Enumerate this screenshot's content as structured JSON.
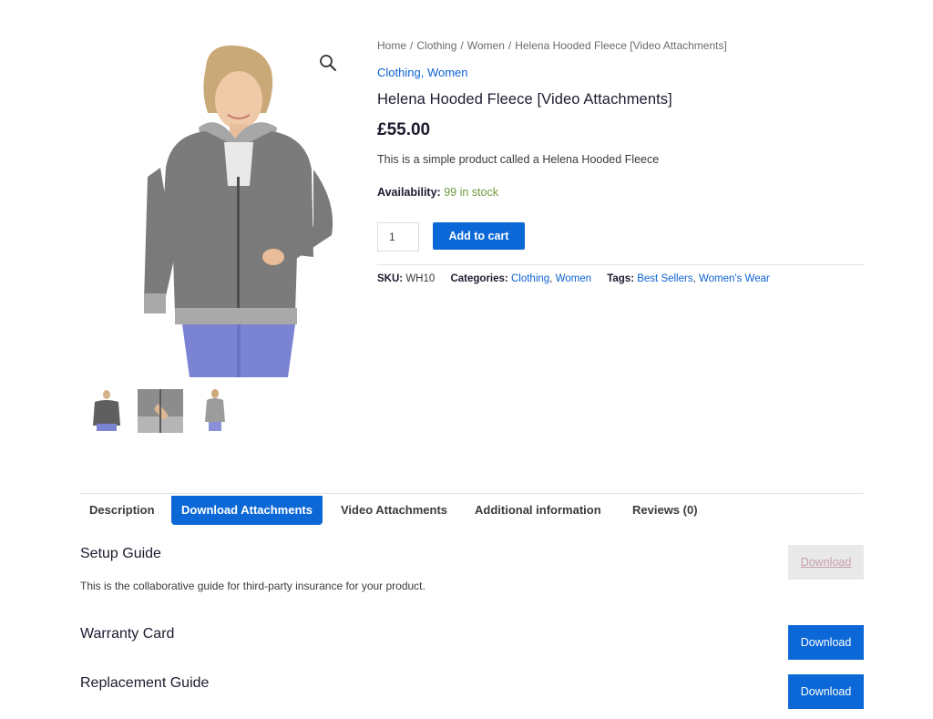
{
  "breadcrumb": [
    "Home",
    "Clothing",
    "Women",
    "Helena Hooded Fleece [Video Attachments]"
  ],
  "breadcrumb_separator": "/",
  "category_links": [
    "Clothing",
    "Women"
  ],
  "category_separator": ",",
  "product": {
    "title": "Helena Hooded Fleece [Video Attachments]",
    "price": "£55.00",
    "description": "This is a simple product called a Helena Hooded Fleece",
    "availability_label": "Availability:",
    "availability_value": "99 in stock",
    "quantity": "1",
    "add_to_cart_label": "Add to cart"
  },
  "meta": {
    "sku_label": "SKU:",
    "sku_value": "WH10",
    "categories_label": "Categories:",
    "categories": [
      "Clothing",
      "Women"
    ],
    "tags_label": "Tags:",
    "tags": [
      "Best Sellers",
      "Women's Wear"
    ]
  },
  "tabs": [
    {
      "label": "Description",
      "active": false
    },
    {
      "label": "Download Attachments",
      "active": true
    },
    {
      "label": "Video Attachments",
      "active": false
    },
    {
      "label": "Additional information",
      "active": false
    },
    {
      "label": "Reviews (0)",
      "active": false
    }
  ],
  "attachments": [
    {
      "title": "Setup Guide",
      "description": "This is the collaborative guide for third-party insurance for your product.",
      "button_label": "Download",
      "button_state": "disabled"
    },
    {
      "title": "Warranty Card",
      "button_label": "Download",
      "button_state": "enabled"
    },
    {
      "title": "Replacement Guide",
      "button_label": "Download",
      "button_state": "enabled"
    }
  ],
  "icons": {
    "zoom": "magnifier-icon"
  },
  "colors": {
    "accent": "#0b68d6",
    "link": "#0b62d2",
    "in_stock": "#6e9a3c",
    "disabled_button_bg": "#e9e9e9",
    "disabled_button_text": "#c8a0ae"
  }
}
